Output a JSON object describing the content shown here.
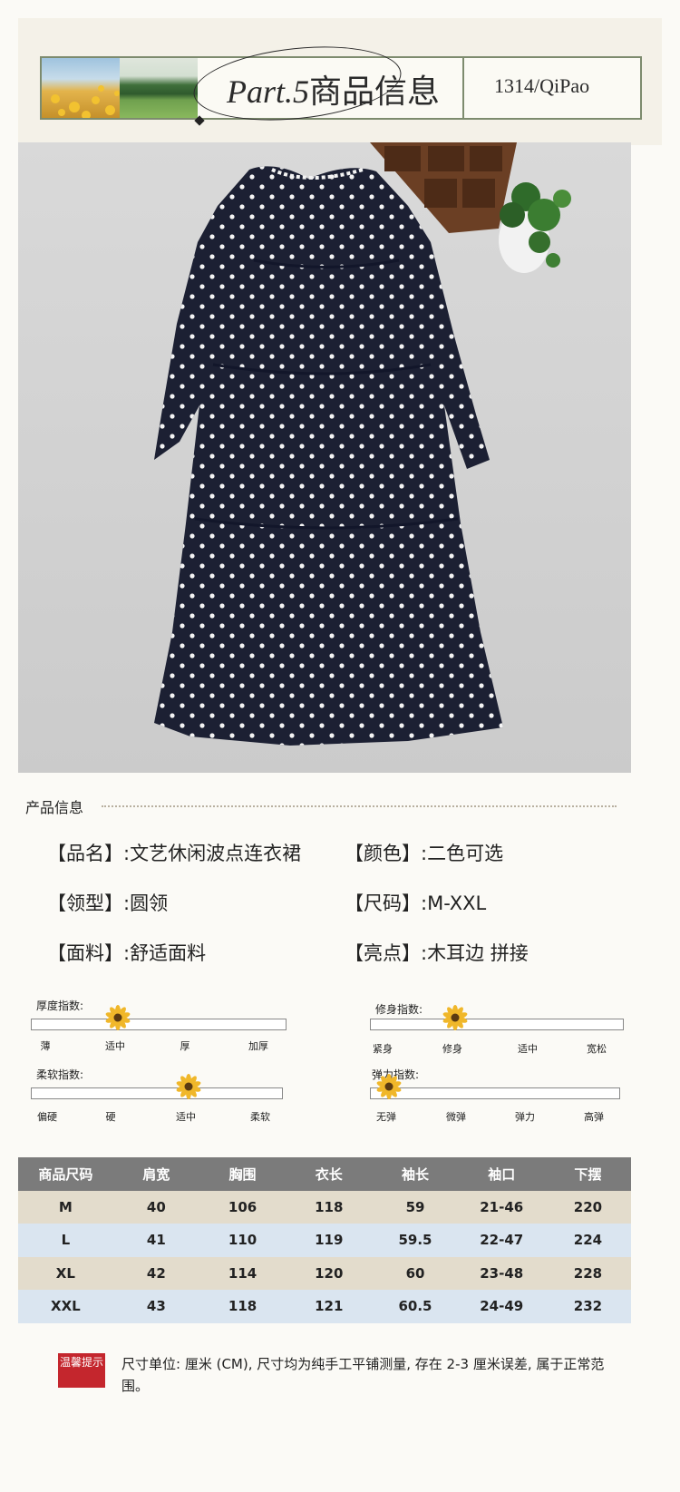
{
  "banner": {
    "part": "Part.5",
    "title": "商品信息",
    "brand": "1314/QiPao"
  },
  "section": {
    "title": "产品信息"
  },
  "info": [
    {
      "label": "【品名】:",
      "value": "文艺休闲波点连衣裙"
    },
    {
      "label": "【颜色】:",
      "value": "二色可选"
    },
    {
      "label": "【领型】:",
      "value": "圆领"
    },
    {
      "label": "【尺码】:",
      "value": "M-XXL"
    },
    {
      "label": "【面料】:",
      "value": "舒适面料"
    },
    {
      "label": "【亮点】:",
      "value": "木耳边 拼接"
    }
  ],
  "indices": [
    {
      "title": "厚度指数:",
      "ticks": [
        "薄",
        "适中",
        "厚",
        "加厚"
      ],
      "selected_index": 1
    },
    {
      "title": "修身指数:",
      "ticks": [
        "紧身",
        "修身",
        "适中",
        "宽松"
      ],
      "selected_index": 1
    },
    {
      "title": "柔软指数:",
      "ticks": [
        "偏硬",
        "硬",
        "适中",
        "柔软"
      ],
      "selected_index": 2
    },
    {
      "title": "弹力指数:",
      "ticks": [
        "无弹",
        "微弹",
        "弹力",
        "高弹"
      ],
      "selected_index": 0
    }
  ],
  "size_table": {
    "headers": [
      "商品尺码",
      "肩宽",
      "胸围",
      "衣长",
      "袖长",
      "袖口",
      "下摆"
    ],
    "rows": [
      [
        "M",
        "40",
        "106",
        "118",
        "59",
        "21-46",
        "220"
      ],
      [
        "L",
        "41",
        "110",
        "119",
        "59.5",
        "22-47",
        "224"
      ],
      [
        "XL",
        "42",
        "114",
        "120",
        "60",
        "23-48",
        "228"
      ],
      [
        "XXL",
        "43",
        "118",
        "121",
        "60.5",
        "24-49",
        "232"
      ]
    ],
    "row_colors": [
      "#e3dccc",
      "#dae5f0",
      "#e3dccc",
      "#dae5f0"
    ]
  },
  "note": {
    "badge": "温馨提示",
    "text": "尺寸单位: 厘米 (CM), 尺寸均为纯手工平铺测量, 存在 2-3 厘米误差, 属于正常范围。"
  },
  "colors": {
    "accent_green": "#7d8b6e",
    "table_header": "#7b7b7b",
    "note_red": "#c4262d",
    "dress_navy": "#1c2033"
  }
}
